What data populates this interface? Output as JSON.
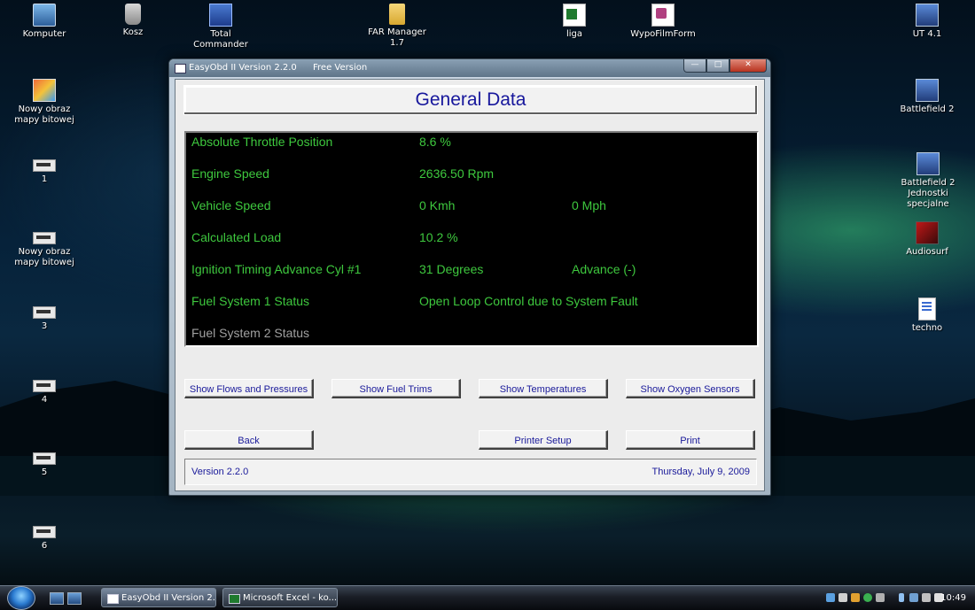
{
  "desktop": {
    "icons": [
      {
        "label": "Komputer",
        "icon": "computer-icon"
      },
      {
        "label": "Kosz",
        "icon": "trash-icon"
      },
      {
        "label": "Total Commander",
        "icon": "total-commander-icon"
      },
      {
        "label": "FAR Manager 1.7",
        "icon": "folder-icon"
      },
      {
        "label": "liga",
        "icon": "excel-file-icon"
      },
      {
        "label": "WypoFilmForm",
        "icon": "document-icon"
      },
      {
        "label": "UT 4.1",
        "icon": "shortcut-icon"
      },
      {
        "label": "Nowy obraz mapy bitowej",
        "icon": "bitmap-icon"
      },
      {
        "label": "1",
        "icon": "drive-icon"
      },
      {
        "label": "Nowy obraz mapy bitowej",
        "icon": "drive-icon"
      },
      {
        "label": "3",
        "icon": "drive-icon"
      },
      {
        "label": "4",
        "icon": "drive-icon"
      },
      {
        "label": "5",
        "icon": "drive-icon"
      },
      {
        "label": "6",
        "icon": "drive-icon"
      },
      {
        "label": "Battlefield 2",
        "icon": "shortcut-icon"
      },
      {
        "label": "Battlefield 2 Jednostki specjalne",
        "icon": "shortcut-icon"
      },
      {
        "label": "Audiosurf",
        "icon": "audiosurf-icon"
      },
      {
        "label": "techno",
        "icon": "text-file-icon"
      }
    ]
  },
  "window": {
    "title": "EasyObd II Version 2.2.0",
    "edition": "Free Version",
    "minimize_glyph": "—",
    "maximize_glyph": "□",
    "close_glyph": "✕"
  },
  "panel": {
    "header": "General Data",
    "rows": [
      {
        "label": "Absolute Throttle Position",
        "value": "8.6 %",
        "extra": ""
      },
      {
        "label": "Engine Speed",
        "value": "2636.50 Rpm",
        "extra": ""
      },
      {
        "label": "Vehicle Speed",
        "value": "0 Kmh",
        "extra": "0 Mph"
      },
      {
        "label": "Calculated Load",
        "value": "10.2 %",
        "extra": ""
      },
      {
        "label": "Ignition Timing Advance Cyl #1",
        "value": "31 Degrees",
        "extra": "Advance (-)"
      },
      {
        "label": "Fuel System 1 Status",
        "value": "Open Loop Control due to System Fault",
        "extra": ""
      },
      {
        "label": "Fuel System 2 Status",
        "value": "",
        "extra": ""
      }
    ]
  },
  "buttons": {
    "flows": "Show Flows and Pressures",
    "fuel_trims": "Show Fuel Trims",
    "temperatures": "Show Temperatures",
    "oxygen": "Show Oxygen Sensors",
    "back": "Back",
    "printer_setup": "Printer Setup",
    "print": "Print"
  },
  "status": {
    "version": "Version 2.2.0",
    "date": "Thursday, July 9, 2009"
  },
  "taskbar": {
    "tasks": [
      {
        "label": "EasyObd II Version 2...."
      },
      {
        "label": "Microsoft Excel - ko..."
      }
    ],
    "clock": "10:49"
  }
}
